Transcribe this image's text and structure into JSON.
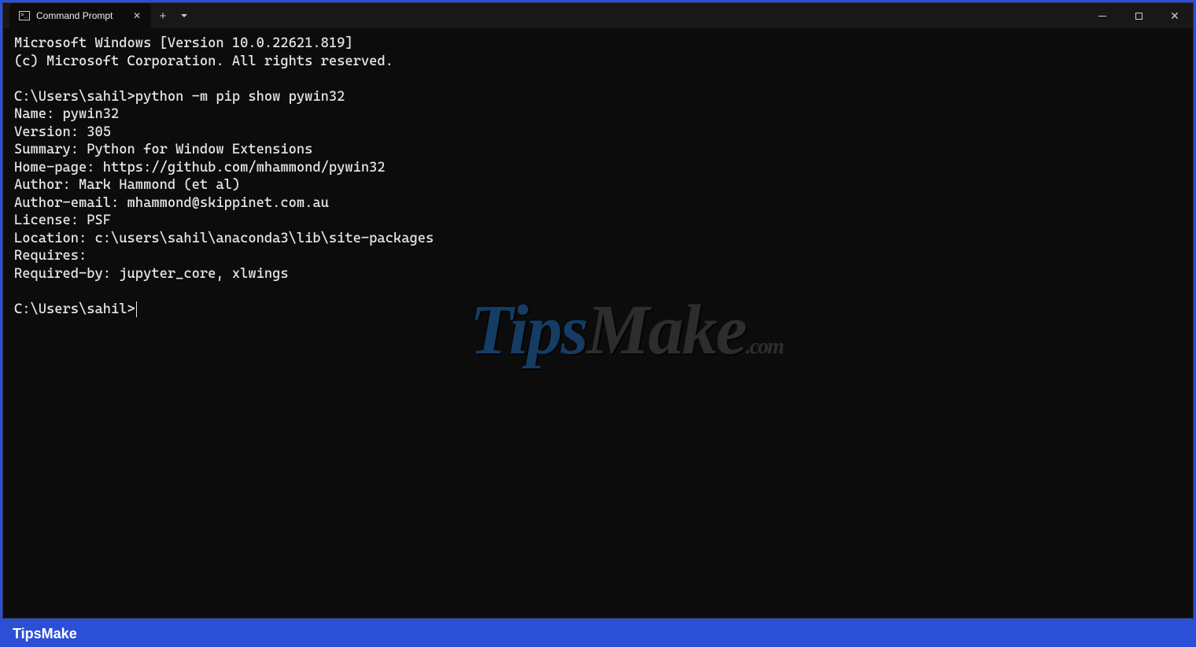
{
  "titlebar": {
    "tab_title": "Command Prompt"
  },
  "terminal": {
    "line1": "Microsoft Windows [Version 10.0.22621.819]",
    "line2": "(c) Microsoft Corporation. All rights reserved.",
    "blank1": "",
    "prompt1": "C:\\Users\\sahil>python -m pip show pywin32",
    "pkg_name": "Name: pywin32",
    "pkg_version": "Version: 305",
    "pkg_summary": "Summary: Python for Window Extensions",
    "pkg_homepage": "Home-page: https://github.com/mhammond/pywin32",
    "pkg_author": "Author: Mark Hammond (et al)",
    "pkg_author_email": "Author-email: mhammond@skippinet.com.au",
    "pkg_license": "License: PSF",
    "pkg_location": "Location: c:\\users\\sahil\\anaconda3\\lib\\site-packages",
    "pkg_requires": "Requires:",
    "pkg_required_by": "Required-by: jupyter_core, xlwings",
    "blank2": "",
    "prompt2": "C:\\Users\\sahil>"
  },
  "watermark": {
    "tips": "Tips",
    "make": "Make",
    "com": ".com"
  },
  "caption": "TipsMake"
}
